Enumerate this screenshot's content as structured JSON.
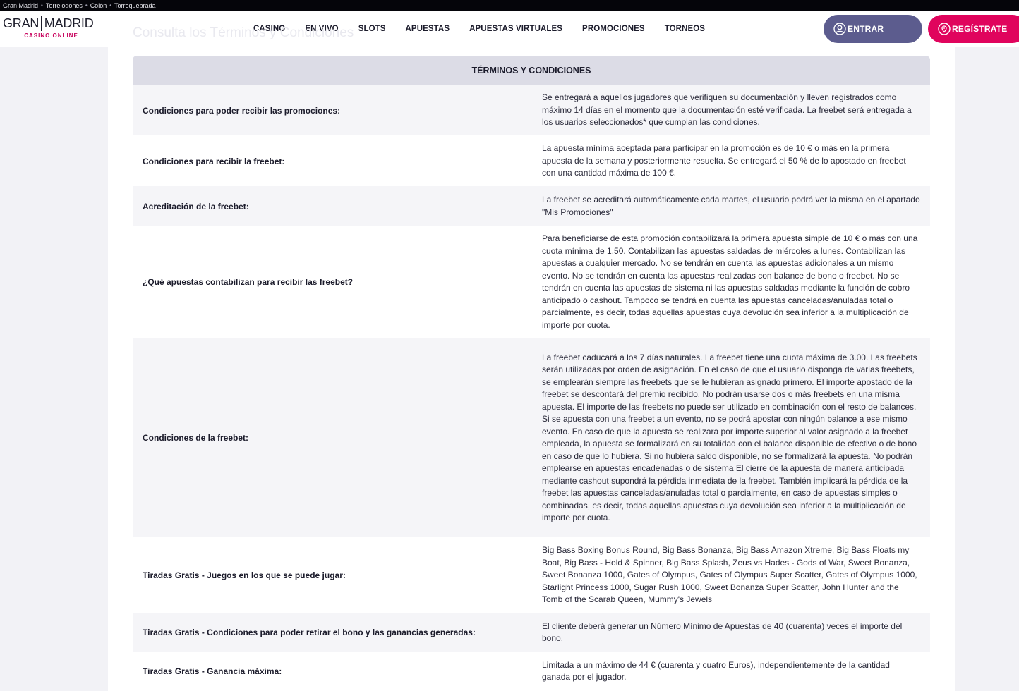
{
  "topbar": {
    "links": [
      "Gran Madrid",
      "Torrelodones",
      "Colón",
      "Torrequebrada"
    ]
  },
  "logo": {
    "line1_left": "GRAN",
    "line1_right": "MADRID",
    "line2": "CASINO ONLINE"
  },
  "nav": {
    "items": [
      "CASINO",
      "EN VIVO",
      "SLOTS",
      "APUESTAS",
      "APUESTAS VIRTUALES",
      "PROMOCIONES",
      "TORNEOS"
    ]
  },
  "buttons": {
    "login": "ENTRAR",
    "register": "REGÍSTRATE"
  },
  "ghost_title": "Consulta los Términos y Condiciones",
  "terms": {
    "header": "TÉRMINOS Y CONDICIONES",
    "rows": [
      {
        "label": "Condiciones para poder recibir las promociones:",
        "text": "Se entregará a aquellos jugadores que verifiquen su documentación y lleven registrados como máximo 14 días en el momento que la documentación esté verificada. La freebet será entregada a los usuarios seleccionados* que cumplan las condiciones."
      },
      {
        "label": "Condiciones para recibir la freebet:",
        "text": "La apuesta mínima aceptada para participar en la promoción es de 10 € o más en la primera apuesta de la semana y posteriormente resuelta. Se entregará el 50 % de lo apostado en freebet con una cantidad máxima de 100 €."
      },
      {
        "label": "Acreditación de la freebet:",
        "text": "La freebet se acreditará automáticamente cada martes, el usuario podrá ver la misma en el apartado \"Mis Promociones\""
      },
      {
        "label": "¿Qué apuestas contabilizan para recibir las freebet?",
        "text": "Para beneficiarse de esta promoción contabilizará la primera apuesta simple de 10 € o más con una cuota mínima de 1.50. Contabilizan las apuestas saldadas de miércoles a lunes. Contabilizan las apuestas a cualquier mercado. No se tendrán en cuenta las apuestas adicionales a un mismo evento. No se tendrán en cuenta las apuestas realizadas con balance de bono o freebet. No se tendrán en cuenta las apuestas de sistema ni las apuestas saldadas mediante la función de cobro anticipado o cashout. Tampoco se tendrá en cuenta las apuestas canceladas/anuladas total o parcialmente, es decir, todas aquellas apuestas cuya devolución sea inferior a la multiplicación de importe por cuota."
      },
      {
        "label": "Condiciones de la freebet:",
        "text": "La freebet caducará a los 7 días naturales. La freebet tiene una cuota máxima de 3.00. Las freebets serán utilizadas por orden de asignación. En el caso de que el usuario disponga de varias freebets, se emplearán siempre las freebets que se le hubieran asignado primero. El importe apostado de la freebet se descontará del premio recibido. No podrán usarse dos o más freebets en una misma apuesta. El importe de las freebets no puede ser utilizado en combinación con el resto de balances. Si se apuesta con una freebet a un evento, no se podrá apostar con ningún balance a ese mismo evento. En caso de que la apuesta se realizara por importe superior al valor asignado a la freebet empleada, la apuesta se formalizará en su totalidad con el balance disponible de efectivo o de bono en caso de que lo hubiera. Si no hubiera saldo disponible, no se formalizará la apuesta. No podrán emplearse en apuestas encadenadas o de sistema El cierre de la apuesta de manera anticipada mediante cashout supondrá la pérdida inmediata de la freebet. También implicará la pérdida de la freebet las apuestas canceladas/anuladas total o parcialmente, en caso de apuestas simples o combinadas, es decir, todas aquellas apuestas cuya devolución sea inferior a la multiplicación de importe por cuota."
      },
      {
        "label": "Tiradas Gratis - Juegos en los que se puede jugar:",
        "text": "Big Bass Boxing Bonus Round, Big Bass Bonanza, Big Bass Amazon Xtreme, Big Bass Floats my Boat, Big Bass - Hold & Spinner, Big Bass Splash, Zeus vs Hades - Gods of War, Sweet Bonanza, Sweet Bonanza 1000, Gates of Olympus, Gates of Olympus Super Scatter, Gates of Olympus 1000, Starlight Princess 1000, Sugar Rush 1000, Sweet Bonanza Super Scatter, John Hunter and the Tomb of the Scarab Queen, Mummy's Jewels"
      },
      {
        "label": "Tiradas Gratis - Condiciones para poder retirar el bono y las ganancias generadas:",
        "text": "El cliente deberá generar un Número Mínimo de Apuestas de 40 (cuarenta) veces el importe del bono."
      },
      {
        "label": "Tiradas Gratis - Ganancia máxima:",
        "text": "Limitada a un máximo de 44 € (cuarenta y cuatro Euros), independientemente de la cantidad ganada por el jugador."
      }
    ]
  }
}
